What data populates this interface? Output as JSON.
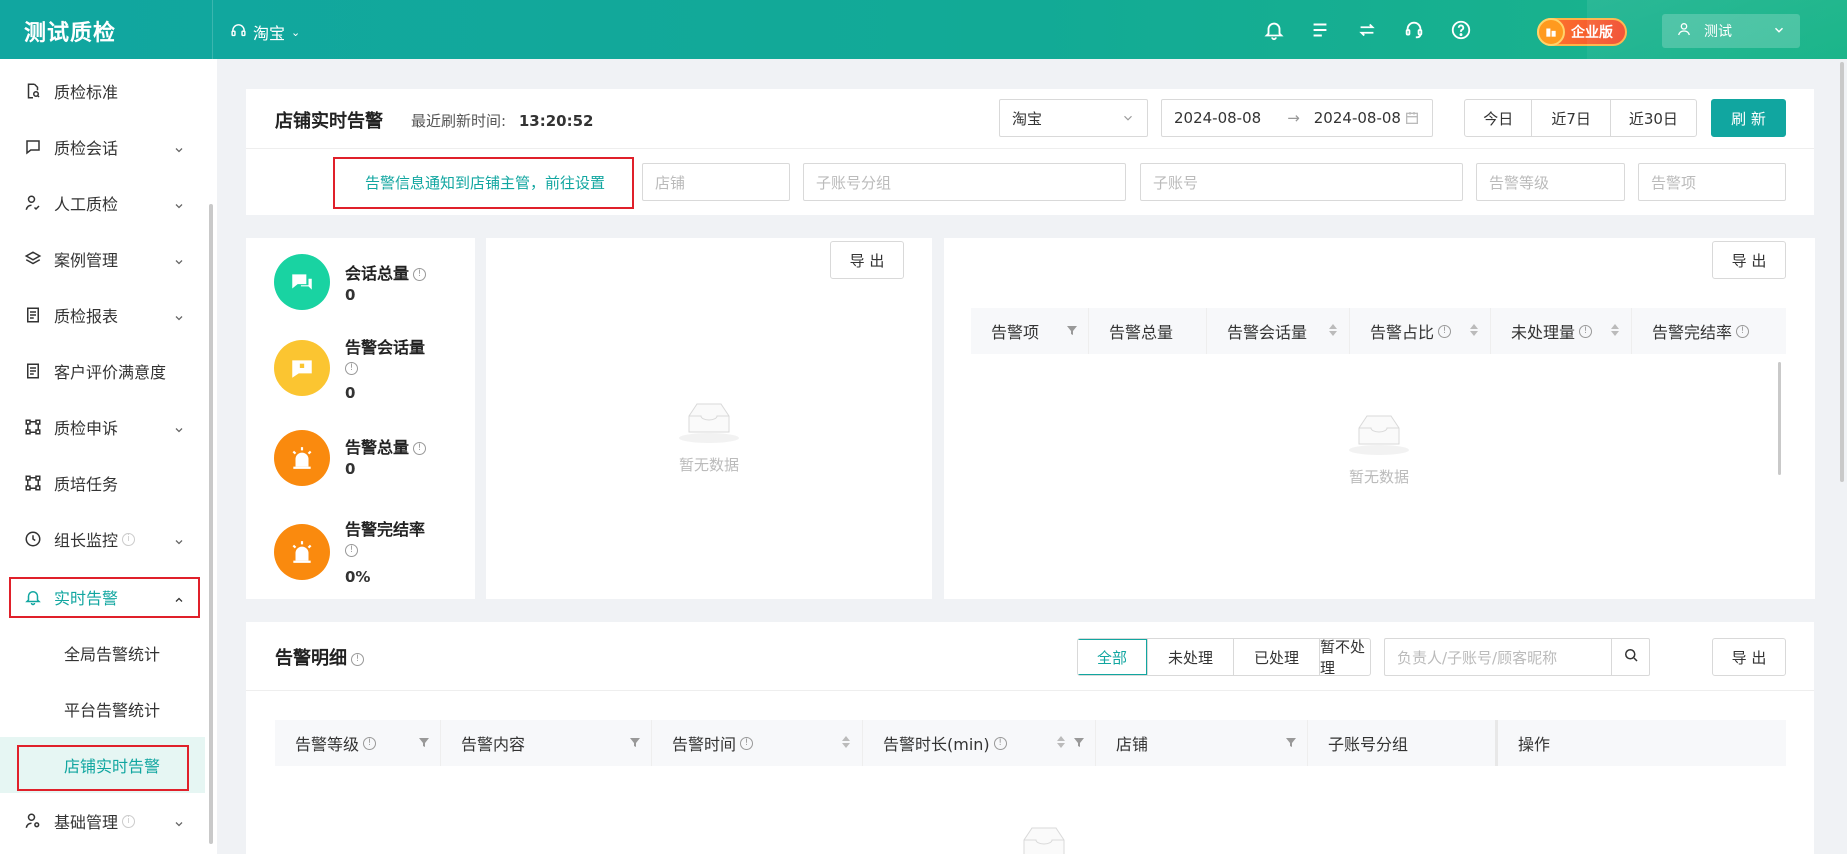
{
  "header": {
    "app_title": "测试质检",
    "platform": "淘宝",
    "enterprise_badge": "企业版",
    "user_name": "测试"
  },
  "sidebar": {
    "items": [
      {
        "label": "质检标准",
        "icon": "doc-search-icon"
      },
      {
        "label": "质检会话",
        "icon": "chat-icon"
      },
      {
        "label": "人工质检",
        "icon": "person-check-icon"
      },
      {
        "label": "案例管理",
        "icon": "layers-icon"
      },
      {
        "label": "质检报表",
        "icon": "report-icon"
      },
      {
        "label": "客户评价满意度",
        "icon": "report-icon"
      },
      {
        "label": "质检申诉",
        "icon": "nodes-icon"
      },
      {
        "label": "质培任务",
        "icon": "nodes-icon"
      },
      {
        "label": "组长监控",
        "icon": "clock-icon"
      },
      {
        "label": "实时告警",
        "icon": "bell-icon"
      },
      {
        "label": "基础管理",
        "icon": "person-gear-icon"
      }
    ],
    "sub_items": [
      "全局告警统计",
      "平台告警统计",
      "店铺实时告警"
    ]
  },
  "filter_panel": {
    "title": "店铺实时告警",
    "refresh_label": "最近刷新时间:",
    "refresh_time": "13:20:52",
    "platform_select": "淘宝",
    "date_start": "2024-08-08",
    "date_end": "2024-08-08",
    "quick_ranges": [
      "今日",
      "近7日",
      "近30日"
    ],
    "refresh_button": "刷 新",
    "notice_link": "告警信息通知到店铺主管，前往设置",
    "placeholders": {
      "shop": "店铺",
      "sub_group": "子账号分组",
      "sub_account": "子账号",
      "alert_level": "告警等级",
      "alert_item": "告警项"
    }
  },
  "stats": [
    {
      "label": "会话总量",
      "value": "0",
      "color": "#19d3a2"
    },
    {
      "label": "告警会话量",
      "value": "0",
      "color": "#fbc531"
    },
    {
      "label": "告警总量",
      "value": "0",
      "color": "#fa8a0e"
    },
    {
      "label": "告警完结率",
      "value": "0%",
      "color": "#fa8a0e"
    }
  ],
  "chart_panel": {
    "export": "导 出",
    "empty": "暂无数据"
  },
  "summary_table": {
    "export": "导 出",
    "columns": [
      "告警项",
      "告警总量",
      "告警会话量",
      "告警占比",
      "未处理量",
      "告警完结率"
    ],
    "empty": "暂无数据"
  },
  "detail": {
    "title": "告警明细",
    "tabs": [
      "全部",
      "未处理",
      "已处理",
      "暂不处理"
    ],
    "search_placeholder": "负责人/子账号/顾客昵称",
    "export": "导 出",
    "columns": [
      "告警等级",
      "告警内容",
      "告警时间",
      "告警时长(min)",
      "店铺",
      "子账号分组",
      "操作"
    ]
  },
  "colors": {
    "accent": "#11a6a0",
    "highlight_box": "#e0202a"
  }
}
